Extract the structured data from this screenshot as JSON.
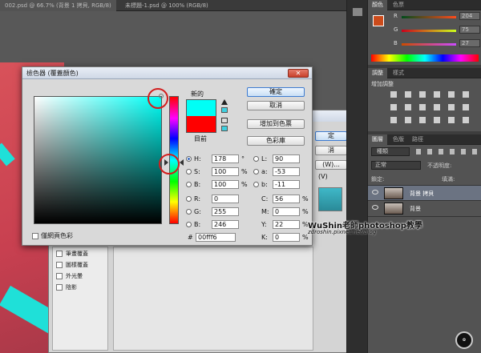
{
  "doc_tabs": [
    {
      "label": "002.psd @ 66.7% (背景 1 拷貝, RGB/8)"
    },
    {
      "label": "未標題-1.psd @ 100% (RGB/8)"
    }
  ],
  "color_picker": {
    "title": "檢色器 (覆蓋顏色)",
    "new_label": "新的",
    "current_label": "目前",
    "new_color": "#00fff6",
    "current_color": "#ff0000",
    "buttons": {
      "ok": "確定",
      "cancel": "取消",
      "add_to_swatches": "增加到色票",
      "color_libraries": "色彩庫"
    },
    "web_only_label": "僅網頁色彩",
    "hsb": [
      {
        "label": "H:",
        "value": "178",
        "unit": "°",
        "selected": true
      },
      {
        "label": "S:",
        "value": "100",
        "unit": "%",
        "selected": false
      },
      {
        "label": "B:",
        "value": "100",
        "unit": "%",
        "selected": false
      }
    ],
    "rgb": [
      {
        "label": "R:",
        "value": "0"
      },
      {
        "label": "G:",
        "value": "255"
      },
      {
        "label": "B:",
        "value": "246"
      }
    ],
    "lab": [
      {
        "label": "L:",
        "value": "90"
      },
      {
        "label": "a:",
        "value": "-53"
      },
      {
        "label": "b:",
        "value": "-11"
      }
    ],
    "cmyk": [
      {
        "label": "C:",
        "value": "56",
        "unit": "%"
      },
      {
        "label": "M:",
        "value": "0",
        "unit": "%"
      },
      {
        "label": "Y:",
        "value": "22",
        "unit": "%"
      },
      {
        "label": "K:",
        "value": "0",
        "unit": "%"
      }
    ],
    "hex_label": "#",
    "hex_value": "00fff6"
  },
  "layer_style_dialog": {
    "buttons": [
      "定",
      "消",
      "(W)...",
      "(V)"
    ],
    "list_items": [
      "筆畫覆蓋",
      "圖樣覆蓋",
      "外光暈",
      "陰影"
    ]
  },
  "right_panels": {
    "color_tabs": [
      "顏色",
      "色票"
    ],
    "color_values": [
      {
        "label": "R",
        "value": "204"
      },
      {
        "label": "G",
        "value": "75"
      },
      {
        "label": "B",
        "value": "27"
      }
    ],
    "adjust_tabs": [
      "調整",
      "樣式"
    ],
    "adjust_title": "增加調整",
    "layers_tabs": [
      "圖層",
      "色版",
      "路徑"
    ],
    "filter_kind": "種類",
    "blend_mode": "正常",
    "opacity_label": "不透明度:",
    "lock_label": "鎖定:",
    "fill_label": "填滿:",
    "layers": [
      {
        "name": "背景 拷貝",
        "selected": true
      },
      {
        "name": "背景",
        "selected": false
      }
    ]
  },
  "watermark": {
    "title": "WuShin老師photoshop教學",
    "url": "zdroshin.pixnet.net/blog"
  }
}
